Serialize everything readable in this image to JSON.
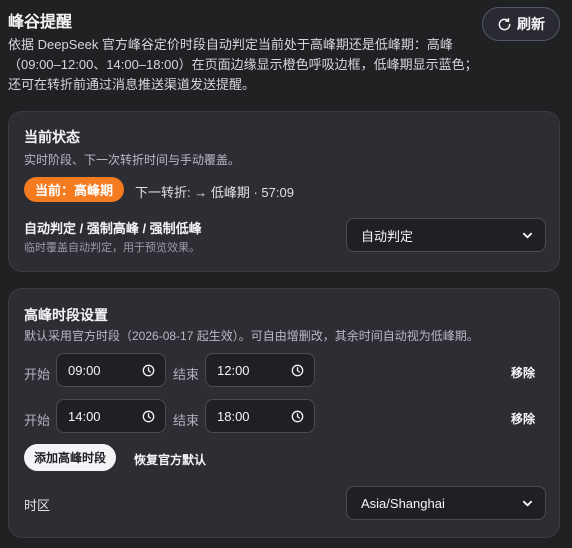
{
  "header": {
    "title": "峰谷提醒",
    "refresh_label": "刷新"
  },
  "description": "依据 DeepSeek 官方峰谷定价时段自动判定当前处于高峰期还是低峰期：高峰（09:00–12:00、14:00–18:00）在页面边缘显示橙色呼吸边框，低峰期显示蓝色；还可在转折前通过消息推送渠道发送提醒。",
  "status_card": {
    "title": "当前状态",
    "subtitle": "实时阶段、下一次转折时间与手动覆盖。",
    "badge": "当前：高峰期",
    "next_transition": "下一转折: → 低峰期 · 57:09",
    "override_label": "自动判定 / 强制高峰 / 强制低峰",
    "override_hint": "临时覆盖自动判定，用于预览效果。",
    "mode_value": "自动判定"
  },
  "peak_card": {
    "title": "高峰时段设置",
    "subtitle": "默认采用官方时段（2026-08-17 起生效）。可自由增删改，其余时间自动视为低峰期。",
    "start_label": "开始",
    "end_label": "结束",
    "remove_label": "移除",
    "ranges": [
      {
        "start": "09:00",
        "end": "12:00"
      },
      {
        "start": "14:00",
        "end": "18:00"
      }
    ],
    "add_label": "添加高峰时段",
    "restore_label": "恢复官方默认",
    "timezone_label": "时区",
    "timezone_value": "Asia/Shanghai"
  },
  "colors": {
    "accent": "#f47b20",
    "background": "#202123",
    "card": "#2d2e34"
  },
  "icons": {
    "refresh": "refresh-icon",
    "clock": "clock-icon",
    "dropdown": "chevron-down-icon"
  }
}
